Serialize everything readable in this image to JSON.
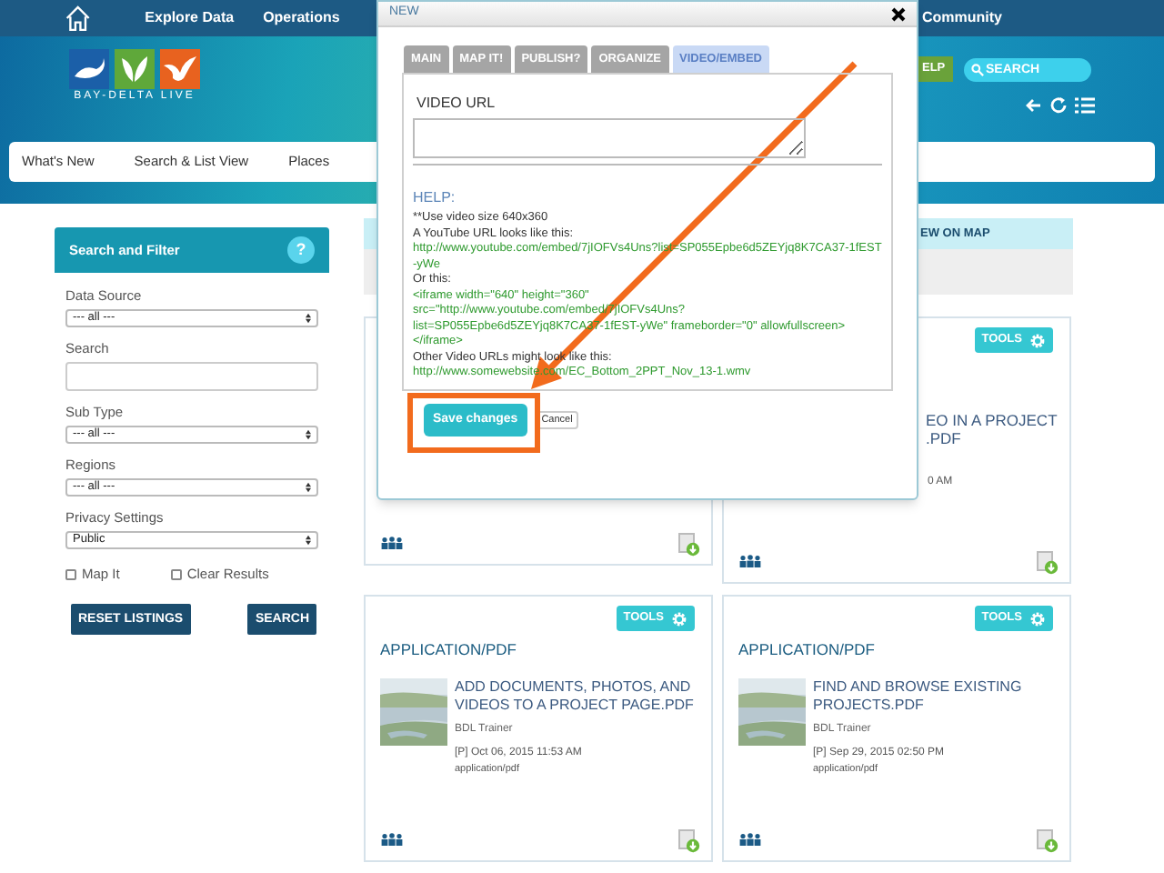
{
  "top_nav": {
    "items": [
      "Explore Data",
      "Operations",
      "Community"
    ]
  },
  "banner": {
    "logo_text": "BAY-DELTA LIVE",
    "help_button": "ELP",
    "search": {
      "placeholder": "SEARCH"
    }
  },
  "nav_tabs": [
    "What's New",
    "Search & List View",
    "Places"
  ],
  "sidebar": {
    "title": "Search and Filter",
    "help": "?",
    "fields": [
      {
        "kind": "select",
        "label": "Data Source",
        "value": "--- all ---"
      },
      {
        "kind": "text",
        "label": "Search"
      },
      {
        "kind": "select",
        "label": "Sub Type",
        "value": "--- all ---"
      },
      {
        "kind": "select",
        "label": "Regions",
        "value": "--- all ---"
      },
      {
        "kind": "select",
        "label": "Privacy Settings",
        "value": "Public"
      }
    ],
    "checkboxes": [
      {
        "label": "Map It",
        "checked": false
      },
      {
        "label": "Clear Results",
        "checked": false
      }
    ],
    "buttons": [
      "RESET LISTINGS",
      "SEARCH"
    ]
  },
  "map_tab": "EW ON MAP",
  "cards": [
    {
      "kind": "covered"
    },
    {
      "kind": "partial",
      "tools": "TOOLS",
      "title_lines": [
        "EO IN A PROJECT",
        ".PDF"
      ],
      "date": "0 AM"
    },
    {
      "kind": "full",
      "tools": "TOOLS",
      "type": "APPLICATION/PDF",
      "title": "ADD DOCUMENTS, PHOTOS, AND VIDEOS TO A PROJECT PAGE.PDF",
      "author": "BDL Trainer",
      "date": "[P] Oct 06, 2015 11:53 AM",
      "mime": "application/pdf"
    },
    {
      "kind": "full",
      "tools": "TOOLS",
      "type": "APPLICATION/PDF",
      "title": "FIND AND BROWSE EXISTING PROJECTS.PDF",
      "author": "BDL Trainer",
      "date": "[P] Sep 29, 2015 02:50 PM",
      "mime": "application/pdf"
    }
  ],
  "dialog": {
    "title": "NEW",
    "tabs": [
      {
        "label": "MAIN",
        "selected": false
      },
      {
        "label": "MAP IT!",
        "selected": false
      },
      {
        "label": "PUBLISH?",
        "selected": false
      },
      {
        "label": "ORGANIZE",
        "selected": false
      },
      {
        "label": "VIDEO/EMBED",
        "selected": true
      }
    ],
    "field_label": "VIDEO URL",
    "help_title": "HELP:",
    "help_lines": [
      {
        "kind": "note",
        "text": "**Use video size 640x360"
      },
      {
        "kind": "note",
        "text": "A YouTube URL looks like this:"
      },
      {
        "kind": "code",
        "text": "http://www.youtube.com/embed/7jIOFVs4Uns?list=SP055Epbe6d5ZEYjq8K7CA37-1fEST-yWe"
      },
      {
        "kind": "note",
        "text": "Or this:"
      },
      {
        "kind": "code",
        "text": "<iframe width=\"640\" height=\"360\""
      },
      {
        "kind": "code",
        "text": "src=\"http://www.youtube.com/embed/7jIOFVs4Uns?"
      },
      {
        "kind": "code",
        "text": "list=SP055Epbe6d5ZEYjq8K7CA37-1fEST-yWe\" frameborder=\"0\" allowfullscreen>"
      },
      {
        "kind": "code",
        "text": "</iframe>"
      },
      {
        "kind": "note",
        "text": "Other Video URLs might look like this:"
      },
      {
        "kind": "code",
        "text": "http://www.somewebsite.com/EC_Bottom_2PPT_Nov_13-1.wmv"
      }
    ],
    "buttons": [
      {
        "kind": "primary",
        "label": "Save changes"
      },
      {
        "kind": "secondary",
        "label": "Cancel"
      }
    ]
  }
}
